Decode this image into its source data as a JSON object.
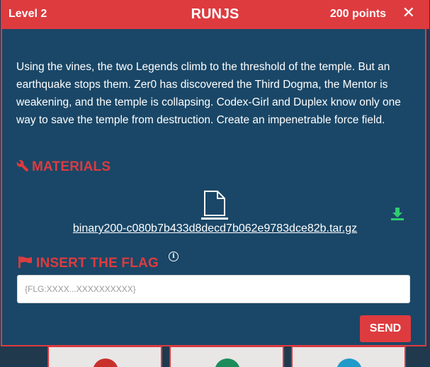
{
  "header": {
    "level": "Level 2",
    "title": "RUNJS",
    "points": "200 points",
    "close_label": "✕"
  },
  "description": "Using the vines, the two Legends climb to the threshold of the temple. But an earthquake stops them. Zer0 has discovered the Third Dogma, the Mentor is weakening, and the temple is collapsing. Codex-Girl and Duplex know only one way to save the temple from destruction. Create an impenetrable force field.",
  "materials": {
    "title": "MATERIALS",
    "icon": "wrench-icon",
    "file_name": "binary200-c080b7b433d8decd7b062e9783dce82b.tar.gz"
  },
  "flag": {
    "title": "INSERT THE FLAG",
    "icon": "flag-icon",
    "info_icon": "ⓘ",
    "placeholder": "{FLG:XXXX...XXXXXXXXXX}",
    "value": ""
  },
  "send_label": "SEND",
  "colors": {
    "accent": "#de3b3f",
    "panel": "#1a4767",
    "download": "#2ecc71"
  }
}
